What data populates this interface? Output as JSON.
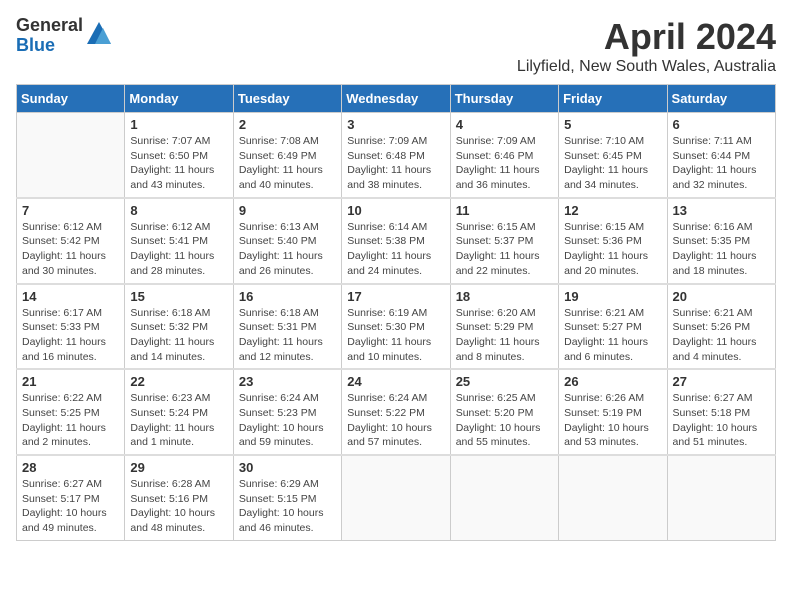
{
  "logo": {
    "general": "General",
    "blue": "Blue"
  },
  "header": {
    "title": "April 2024",
    "subtitle": "Lilyfield, New South Wales, Australia"
  },
  "weekdays": [
    "Sunday",
    "Monday",
    "Tuesday",
    "Wednesday",
    "Thursday",
    "Friday",
    "Saturday"
  ],
  "weeks": [
    [
      {
        "day": "",
        "info": ""
      },
      {
        "day": "1",
        "info": "Sunrise: 7:07 AM\nSunset: 6:50 PM\nDaylight: 11 hours\nand 43 minutes."
      },
      {
        "day": "2",
        "info": "Sunrise: 7:08 AM\nSunset: 6:49 PM\nDaylight: 11 hours\nand 40 minutes."
      },
      {
        "day": "3",
        "info": "Sunrise: 7:09 AM\nSunset: 6:48 PM\nDaylight: 11 hours\nand 38 minutes."
      },
      {
        "day": "4",
        "info": "Sunrise: 7:09 AM\nSunset: 6:46 PM\nDaylight: 11 hours\nand 36 minutes."
      },
      {
        "day": "5",
        "info": "Sunrise: 7:10 AM\nSunset: 6:45 PM\nDaylight: 11 hours\nand 34 minutes."
      },
      {
        "day": "6",
        "info": "Sunrise: 7:11 AM\nSunset: 6:44 PM\nDaylight: 11 hours\nand 32 minutes."
      }
    ],
    [
      {
        "day": "7",
        "info": "Sunrise: 6:12 AM\nSunset: 5:42 PM\nDaylight: 11 hours\nand 30 minutes."
      },
      {
        "day": "8",
        "info": "Sunrise: 6:12 AM\nSunset: 5:41 PM\nDaylight: 11 hours\nand 28 minutes."
      },
      {
        "day": "9",
        "info": "Sunrise: 6:13 AM\nSunset: 5:40 PM\nDaylight: 11 hours\nand 26 minutes."
      },
      {
        "day": "10",
        "info": "Sunrise: 6:14 AM\nSunset: 5:38 PM\nDaylight: 11 hours\nand 24 minutes."
      },
      {
        "day": "11",
        "info": "Sunrise: 6:15 AM\nSunset: 5:37 PM\nDaylight: 11 hours\nand 22 minutes."
      },
      {
        "day": "12",
        "info": "Sunrise: 6:15 AM\nSunset: 5:36 PM\nDaylight: 11 hours\nand 20 minutes."
      },
      {
        "day": "13",
        "info": "Sunrise: 6:16 AM\nSunset: 5:35 PM\nDaylight: 11 hours\nand 18 minutes."
      }
    ],
    [
      {
        "day": "14",
        "info": "Sunrise: 6:17 AM\nSunset: 5:33 PM\nDaylight: 11 hours\nand 16 minutes."
      },
      {
        "day": "15",
        "info": "Sunrise: 6:18 AM\nSunset: 5:32 PM\nDaylight: 11 hours\nand 14 minutes."
      },
      {
        "day": "16",
        "info": "Sunrise: 6:18 AM\nSunset: 5:31 PM\nDaylight: 11 hours\nand 12 minutes."
      },
      {
        "day": "17",
        "info": "Sunrise: 6:19 AM\nSunset: 5:30 PM\nDaylight: 11 hours\nand 10 minutes."
      },
      {
        "day": "18",
        "info": "Sunrise: 6:20 AM\nSunset: 5:29 PM\nDaylight: 11 hours\nand 8 minutes."
      },
      {
        "day": "19",
        "info": "Sunrise: 6:21 AM\nSunset: 5:27 PM\nDaylight: 11 hours\nand 6 minutes."
      },
      {
        "day": "20",
        "info": "Sunrise: 6:21 AM\nSunset: 5:26 PM\nDaylight: 11 hours\nand 4 minutes."
      }
    ],
    [
      {
        "day": "21",
        "info": "Sunrise: 6:22 AM\nSunset: 5:25 PM\nDaylight: 11 hours\nand 2 minutes."
      },
      {
        "day": "22",
        "info": "Sunrise: 6:23 AM\nSunset: 5:24 PM\nDaylight: 11 hours\nand 1 minute."
      },
      {
        "day": "23",
        "info": "Sunrise: 6:24 AM\nSunset: 5:23 PM\nDaylight: 10 hours\nand 59 minutes."
      },
      {
        "day": "24",
        "info": "Sunrise: 6:24 AM\nSunset: 5:22 PM\nDaylight: 10 hours\nand 57 minutes."
      },
      {
        "day": "25",
        "info": "Sunrise: 6:25 AM\nSunset: 5:20 PM\nDaylight: 10 hours\nand 55 minutes."
      },
      {
        "day": "26",
        "info": "Sunrise: 6:26 AM\nSunset: 5:19 PM\nDaylight: 10 hours\nand 53 minutes."
      },
      {
        "day": "27",
        "info": "Sunrise: 6:27 AM\nSunset: 5:18 PM\nDaylight: 10 hours\nand 51 minutes."
      }
    ],
    [
      {
        "day": "28",
        "info": "Sunrise: 6:27 AM\nSunset: 5:17 PM\nDaylight: 10 hours\nand 49 minutes."
      },
      {
        "day": "29",
        "info": "Sunrise: 6:28 AM\nSunset: 5:16 PM\nDaylight: 10 hours\nand 48 minutes."
      },
      {
        "day": "30",
        "info": "Sunrise: 6:29 AM\nSunset: 5:15 PM\nDaylight: 10 hours\nand 46 minutes."
      },
      {
        "day": "",
        "info": ""
      },
      {
        "day": "",
        "info": ""
      },
      {
        "day": "",
        "info": ""
      },
      {
        "day": "",
        "info": ""
      }
    ]
  ]
}
